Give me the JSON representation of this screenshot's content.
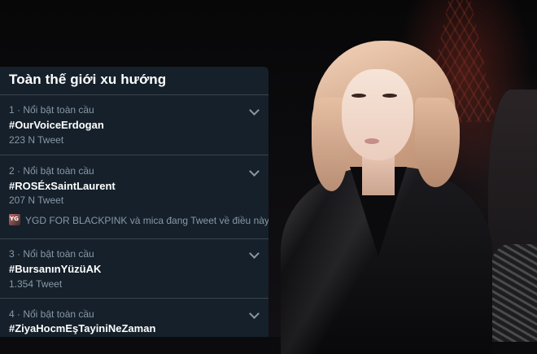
{
  "panel": {
    "title": "Toàn thế giới xu hướng",
    "trends": [
      {
        "meta": "1 · Nổi bật toàn cầu",
        "hashtag": "#OurVoiceErdogan",
        "count": "223 N Tweet",
        "context": null
      },
      {
        "meta": "2 · Nổi bật toàn cầu",
        "hashtag": "#ROSÉxSaintLaurent",
        "count": "207 N Tweet",
        "context": "YGD FOR BLACKPINK và mica đang Tweet về điều này"
      },
      {
        "meta": "3 · Nổi bật toàn cầu",
        "hashtag": "#BursanınYüzüAK",
        "count": "1.354 Tweet",
        "context": null
      },
      {
        "meta": "4 · Nổi bật toàn cầu",
        "hashtag": "#ZiyaHocmEşTayiniNeZaman",
        "count": "",
        "context": null
      }
    ],
    "colors": {
      "background": "#15202b",
      "primary_text": "#ffffff",
      "secondary_text": "#8899a6",
      "divider": "#38444d"
    },
    "icons": {
      "expand": "chevron-down-icon"
    }
  }
}
